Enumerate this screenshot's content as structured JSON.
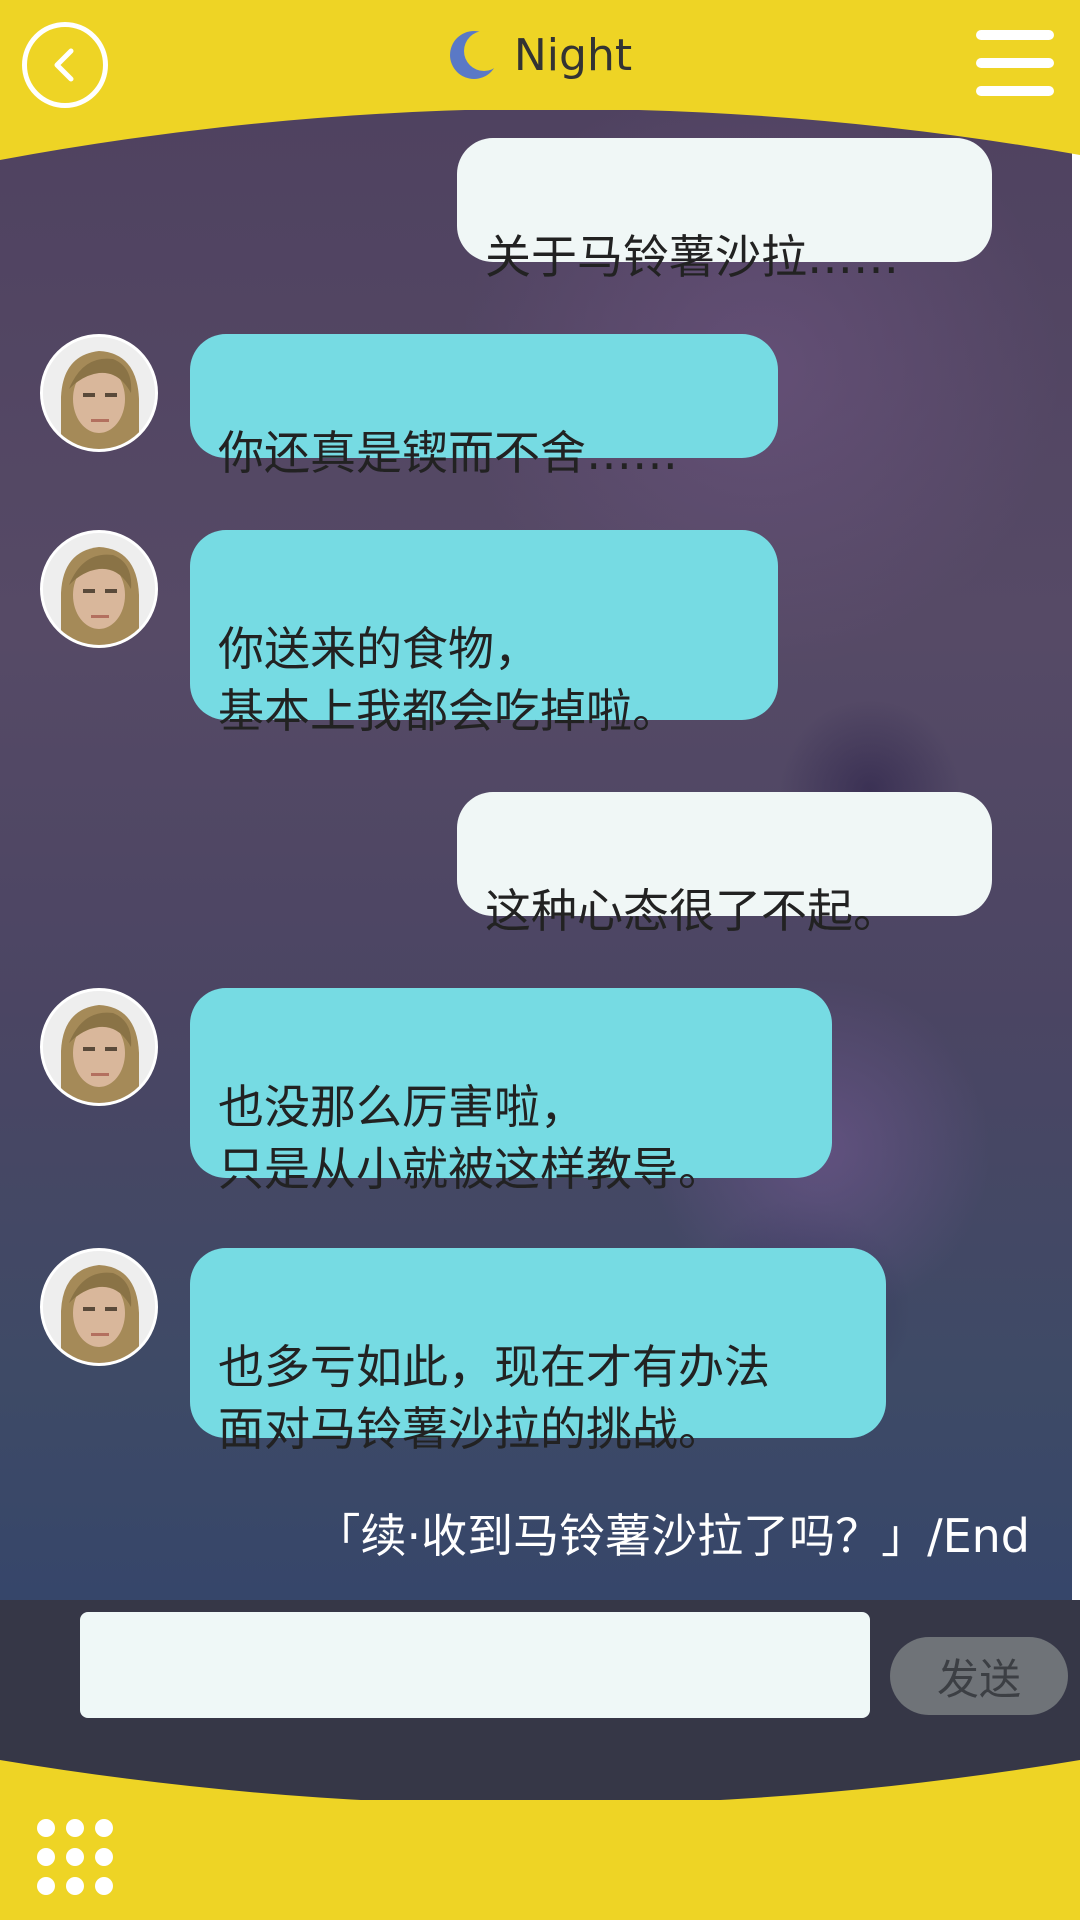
{
  "header": {
    "title": "Night",
    "back_icon": "back-arrow-icon",
    "menu_icon": "hamburger-menu-icon",
    "title_icon": "crescent-moon-icon"
  },
  "colors": {
    "accent_yellow": "#eed425",
    "bubble_them": "#76dbe3",
    "bubble_me": "#f0f7f6",
    "input_bar": "#363747"
  },
  "messages": [
    {
      "side": "me",
      "text": "关于马铃薯沙拉……"
    },
    {
      "side": "them",
      "text": "你还真是锲而不舍……"
    },
    {
      "side": "them",
      "text": "你送来的食物，\n基本上我都会吃掉啦。"
    },
    {
      "side": "me",
      "text": "这种心态很了不起。"
    },
    {
      "side": "them",
      "text": "也没那么厉害啦，\n只是从小就被这样教导。"
    },
    {
      "side": "them",
      "text": "也多亏如此，现在才有办法\n面对马铃薯沙拉的挑战。"
    }
  ],
  "caption": "「续·收到马铃薯沙拉了吗？」/End",
  "composer": {
    "input_value": "",
    "send_label": "发送"
  },
  "footer": {
    "grid_icon": "app-grid-icon"
  }
}
